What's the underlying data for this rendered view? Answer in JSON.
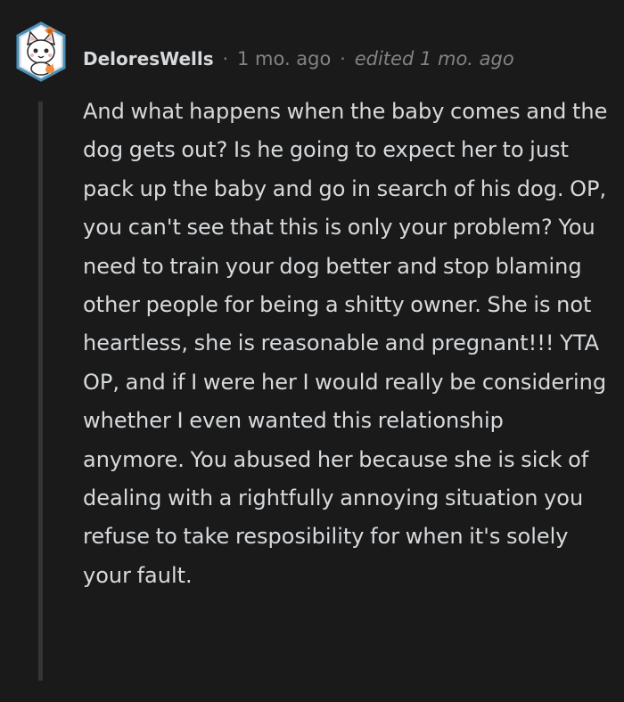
{
  "comment": {
    "username": "DeloresWells",
    "separator": "·",
    "timestamp": "1 mo. ago",
    "edited": "edited 1 mo. ago",
    "body": "And what happens when the baby comes and the dog gets out? Is he going to expect her to just pack up the baby and go in search of his dog. OP, you can't see that this is only your problem? You need to train your dog better and stop blaming other people for being a shitty owner. She is not heartless, she is reasonable and pregnant!!! YTA OP, and if I were her I would really be considering whether I even wanted this relationship anymore. You abused her because she is sick of dealing with a rightfully annoying situation you refuse to take resposibility for when it's solely your fault."
  },
  "avatar": {
    "icon": "cat-avatar-icon",
    "frame_color": "#4a90b8",
    "bow_color": "#f08a3c"
  },
  "colors": {
    "background": "#1a1a1b",
    "text": "#d7dadc",
    "meta": "#818384",
    "thread_line": "#343536"
  }
}
